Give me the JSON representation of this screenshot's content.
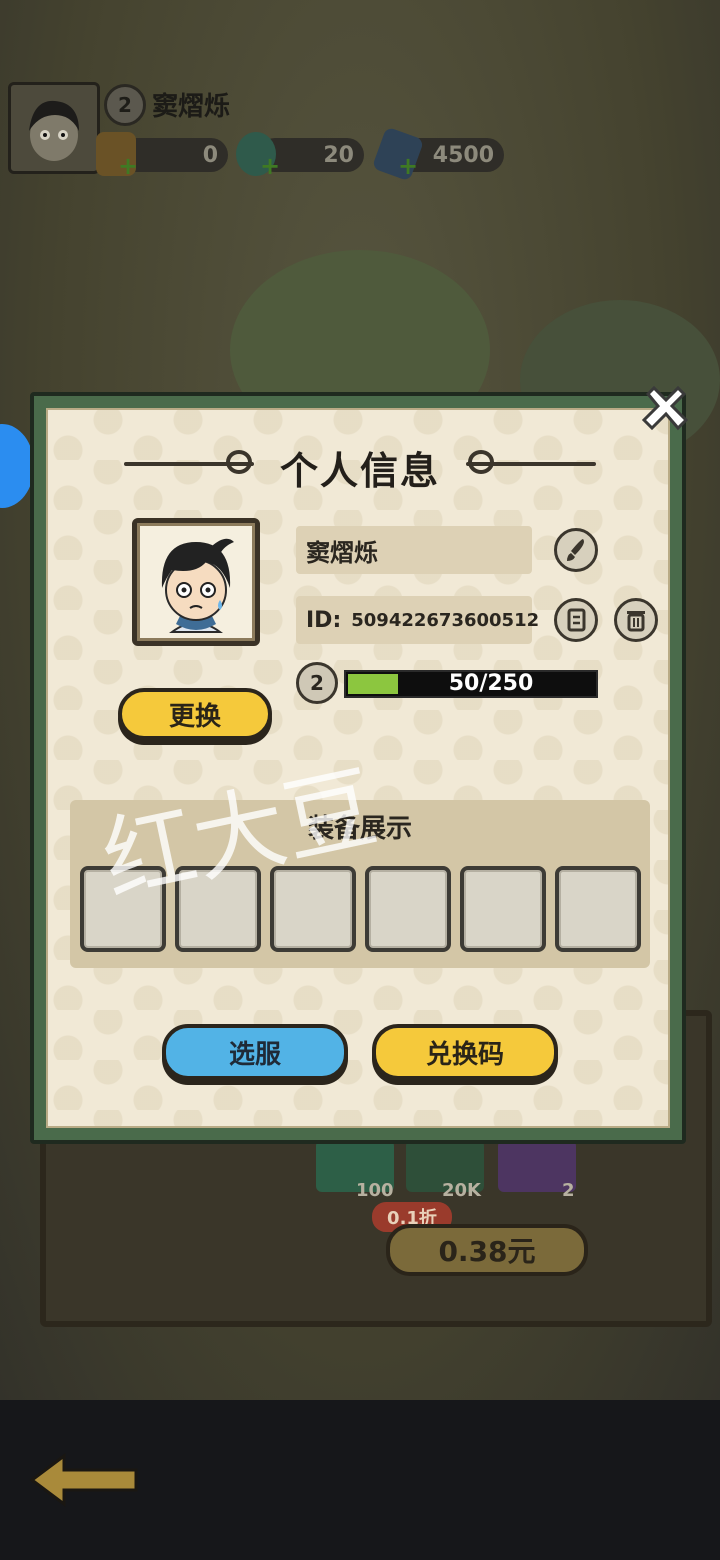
{
  "hud": {
    "player_level": "2",
    "player_name": "窦熠烁",
    "resources": [
      {
        "name": "gold",
        "value": "0"
      },
      {
        "name": "jade",
        "value": "20"
      },
      {
        "name": "crystal",
        "value": "4500"
      }
    ]
  },
  "dialog": {
    "title": "个人信息",
    "name": "窦熠烁",
    "id_label": "ID:",
    "id_value": "509422673600512",
    "level": "2",
    "xp_text": "50/250",
    "xp_progress": 0.2,
    "change_button": "更换",
    "equip_title": "装备展示",
    "equip_slots": 6,
    "select_server_button": "选服",
    "redeem_code_button": "兑换码"
  },
  "watermark": "红大豆",
  "background_shop": {
    "items": [
      {
        "icon": "jade-icon",
        "count": "100"
      },
      {
        "icon": "crystal-icon",
        "count": "20K"
      },
      {
        "icon": "cloud-icon",
        "count": "2"
      }
    ],
    "discount": "0.1折",
    "price": "0.38元"
  },
  "colors": {
    "accent_yellow": "#f5c93b",
    "accent_blue": "#52b3e6",
    "xp_green": "#8cc63f",
    "frame_green": "#4a6b4b",
    "parchment": "#f1e9d6"
  }
}
